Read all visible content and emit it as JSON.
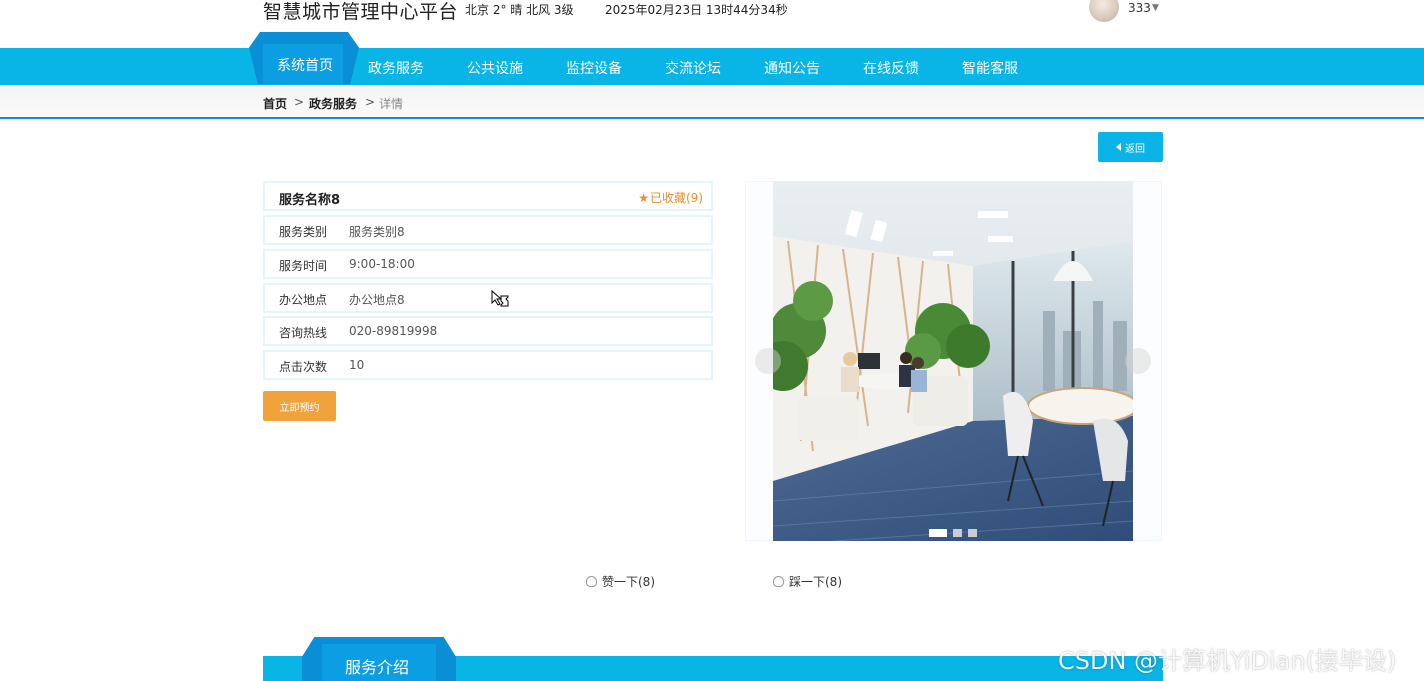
{
  "header": {
    "site_title": "智慧城市管理中心平台",
    "weather": "北京 2° 晴 北风 3级",
    "datetime": "2025年02月23日 13时44分34秒",
    "user_name": "333"
  },
  "nav": {
    "items": [
      "系统首页",
      "政务服务",
      "公共设施",
      "监控设备",
      "交流论坛",
      "通知公告",
      "在线反馈",
      "智能客服"
    ],
    "active": "系统首页"
  },
  "breadcrumb": {
    "home": "首页",
    "section": "政务服务",
    "current": "详情",
    "separator": ">"
  },
  "back_button": "返回",
  "service": {
    "name": "服务名称8",
    "favorite": "已收藏(9)",
    "rows": [
      {
        "label": "服务类别",
        "value": "服务类别8"
      },
      {
        "label": "服务时间",
        "value": "9:00-18:00"
      },
      {
        "label": "办公地点",
        "value": "办公地点8"
      },
      {
        "label": "咨询热线",
        "value": "020-89819998"
      },
      {
        "label": "点击次数",
        "value": "10"
      }
    ],
    "book_button": "立即预约"
  },
  "carousel": {
    "slide_count": 3,
    "active_slide": 1,
    "image_icon": "office-photo"
  },
  "votes": {
    "like": "赞一下(8)",
    "dislike": "踩一下(8)"
  },
  "section_title": "服务介绍",
  "watermark": "CSDN @计算机YiDian(接毕设)",
  "colors": {
    "nav_bg": "#08b5e6",
    "nav_active": "#0a8fd6",
    "accent_orange": "#f0a33a",
    "favorite_orange": "#e6902b"
  }
}
